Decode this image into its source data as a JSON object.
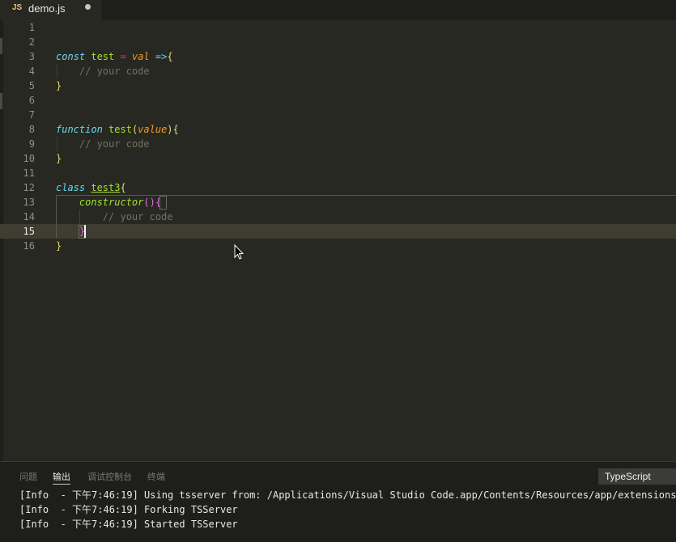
{
  "tab": {
    "icon": "JS",
    "filename": "demo.js",
    "dirty_icon": "unsaved-dot"
  },
  "editor": {
    "line_numbers": [
      "1",
      "2",
      "3",
      "4",
      "5",
      "6",
      "7",
      "8",
      "9",
      "10",
      "11",
      "12",
      "13",
      "14",
      "15",
      "16"
    ],
    "current_line": "15",
    "code": {
      "l3": {
        "kw": "const",
        "name": "test",
        "op": "=",
        "param": "val",
        "arrow": "=>",
        "open": "{"
      },
      "l4": {
        "comment": "// your code"
      },
      "l5": {
        "close": "}"
      },
      "l8": {
        "kw": "function",
        "name": "test",
        "open_paren": "(",
        "param": "value",
        "close_paren": ")",
        "open": "{"
      },
      "l9": {
        "comment": "// your code"
      },
      "l10": {
        "close": "}"
      },
      "l12": {
        "kw": "class",
        "name": "test3",
        "open": "{"
      },
      "l13": {
        "name": "constructor",
        "parens": "()",
        "open": "{"
      },
      "l14": {
        "comment": "// your code"
      },
      "l15": {
        "close": "}"
      },
      "l16": {
        "close": "}"
      }
    }
  },
  "panel": {
    "tabs": [
      "问题",
      "输出",
      "调试控制台",
      "终端"
    ],
    "active_tab": "输出",
    "channel_select": "TypeScript",
    "log": [
      "[Info  - 下午7:46:19] Using tsserver from: /Applications/Visual Studio Code.app/Contents/Resources/app/extensions",
      "[Info  - 下午7:46:19] Forking TSServer",
      "[Info  - 下午7:46:19] Started TSServer"
    ]
  },
  "colors": {
    "background": "#272822",
    "keyword": "#66d9ef",
    "function_name": "#a6e22e",
    "parameter": "#fd971f",
    "operator": "#f92672",
    "brace": "#e6db74",
    "comment": "#75715e"
  }
}
